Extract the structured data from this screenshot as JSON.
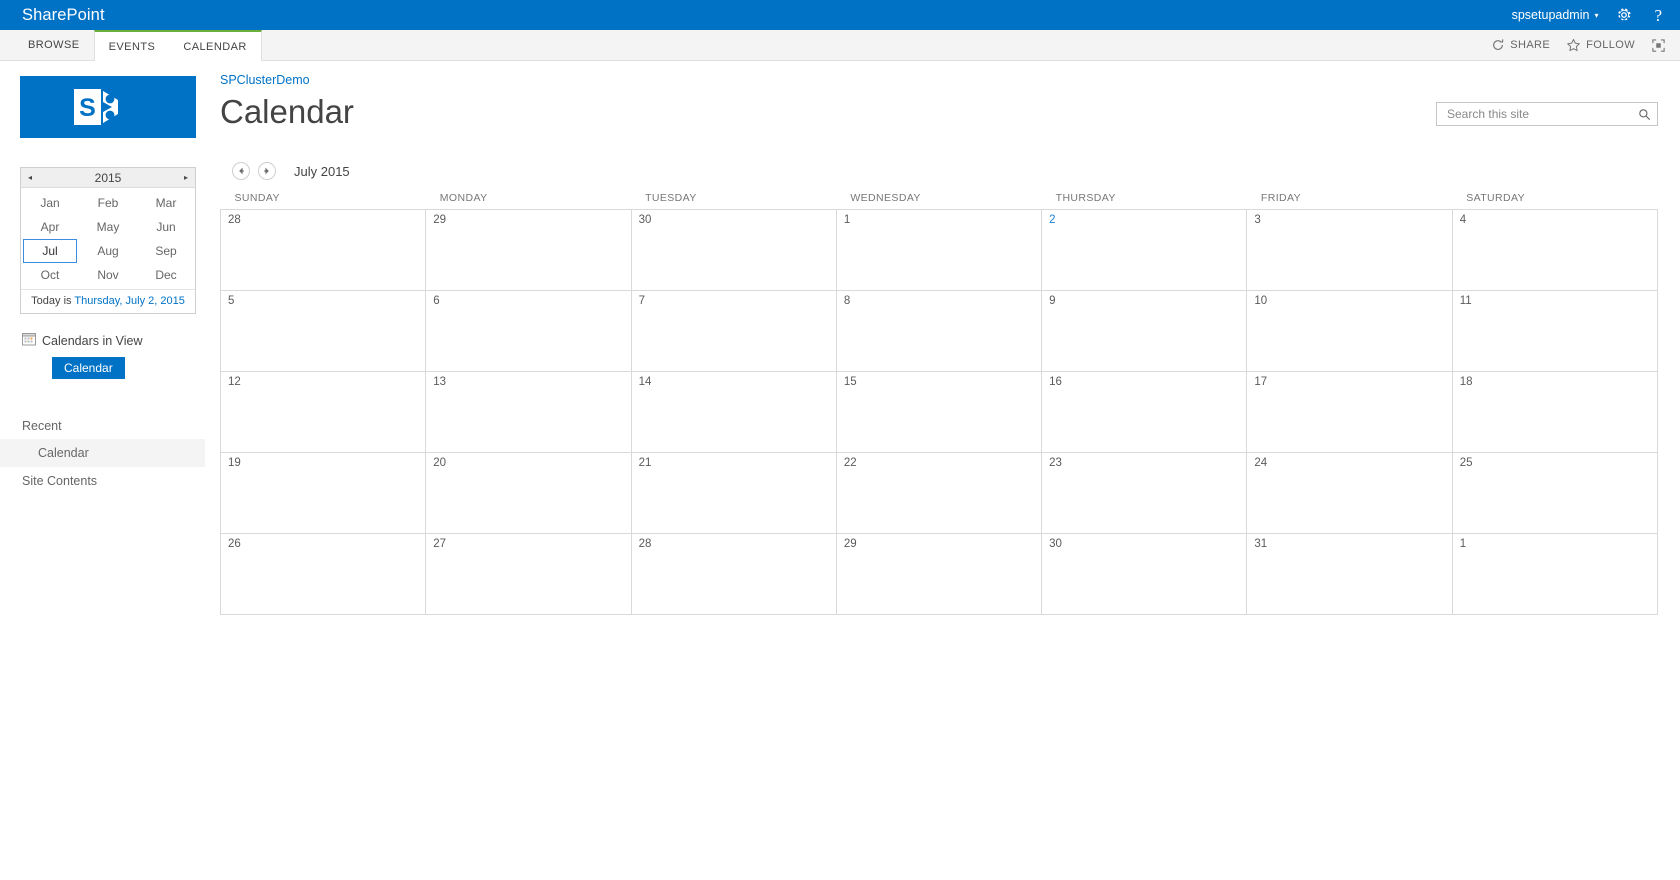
{
  "suite": {
    "brand": "SharePoint",
    "user": "spsetupadmin",
    "user_caret": "▾",
    "settings_icon": "gear-icon",
    "help_icon": "?",
    "help_label": "?"
  },
  "ribbon": {
    "tabs": [
      {
        "label": "BROWSE",
        "grouped": false
      },
      {
        "label": "EVENTS",
        "grouped": true
      },
      {
        "label": "CALENDAR",
        "grouped": true
      }
    ],
    "actions": [
      {
        "label": "SHARE",
        "icon": "share-icon"
      },
      {
        "label": "FOLLOW",
        "icon": "star-icon"
      },
      {
        "label": "",
        "icon": "focus-on-content-icon"
      }
    ]
  },
  "header": {
    "breadcrumb": "SPClusterDemo",
    "title": "Calendar",
    "logo_icon": "sharepoint-logo"
  },
  "search": {
    "placeholder": "Search this site",
    "value": "",
    "icon": "search-icon"
  },
  "date_picker": {
    "prev_arrow": "◂",
    "next_arrow": "▸",
    "year": "2015",
    "months": [
      "Jan",
      "Feb",
      "Mar",
      "Apr",
      "May",
      "Jun",
      "Jul",
      "Aug",
      "Sep",
      "Oct",
      "Nov",
      "Dec"
    ],
    "selected_month": "Jul",
    "today_prefix": "Today is ",
    "today_link": "Thursday, July 2, 2015"
  },
  "calendars_in_view": {
    "icon": "calendar-small-icon",
    "label": "Calendars in View",
    "chip": "Calendar"
  },
  "left_nav": {
    "recent_label": "Recent",
    "items": [
      {
        "label": "Calendar",
        "selected": true,
        "root": false
      },
      {
        "label": "Site Contents",
        "selected": false,
        "root": true
      }
    ]
  },
  "calendar": {
    "prev_icon": "arrow-left-icon",
    "next_icon": "arrow-right-icon",
    "period": "July 2015",
    "day_headers": [
      "SUNDAY",
      "MONDAY",
      "TUESDAY",
      "WEDNESDAY",
      "THURSDAY",
      "FRIDAY",
      "SATURDAY"
    ],
    "today_column_index": 4,
    "weeks": [
      [
        {
          "day": "28",
          "today": false
        },
        {
          "day": "29",
          "today": false
        },
        {
          "day": "30",
          "today": false
        },
        {
          "day": "1",
          "today": false
        },
        {
          "day": "2",
          "today": true
        },
        {
          "day": "3",
          "today": false
        },
        {
          "day": "4",
          "today": false
        }
      ],
      [
        {
          "day": "5",
          "today": false
        },
        {
          "day": "6",
          "today": false
        },
        {
          "day": "7",
          "today": false
        },
        {
          "day": "8",
          "today": false
        },
        {
          "day": "9",
          "today": false
        },
        {
          "day": "10",
          "today": false
        },
        {
          "day": "11",
          "today": false
        }
      ],
      [
        {
          "day": "12",
          "today": false
        },
        {
          "day": "13",
          "today": false
        },
        {
          "day": "14",
          "today": false
        },
        {
          "day": "15",
          "today": false
        },
        {
          "day": "16",
          "today": false
        },
        {
          "day": "17",
          "today": false
        },
        {
          "day": "18",
          "today": false
        }
      ],
      [
        {
          "day": "19",
          "today": false
        },
        {
          "day": "20",
          "today": false
        },
        {
          "day": "21",
          "today": false
        },
        {
          "day": "22",
          "today": false
        },
        {
          "day": "23",
          "today": false
        },
        {
          "day": "24",
          "today": false
        },
        {
          "day": "25",
          "today": false
        }
      ],
      [
        {
          "day": "26",
          "today": false
        },
        {
          "day": "27",
          "today": false
        },
        {
          "day": "28",
          "today": false
        },
        {
          "day": "29",
          "today": false
        },
        {
          "day": "30",
          "today": false
        },
        {
          "day": "31",
          "today": false
        },
        {
          "day": "1",
          "today": false
        }
      ]
    ]
  },
  "colors": {
    "suite_blue": "#0072c6",
    "ribbon_green": "#69af3c",
    "today_blue": "#1f7fd0",
    "link_blue": "#0072c6"
  }
}
